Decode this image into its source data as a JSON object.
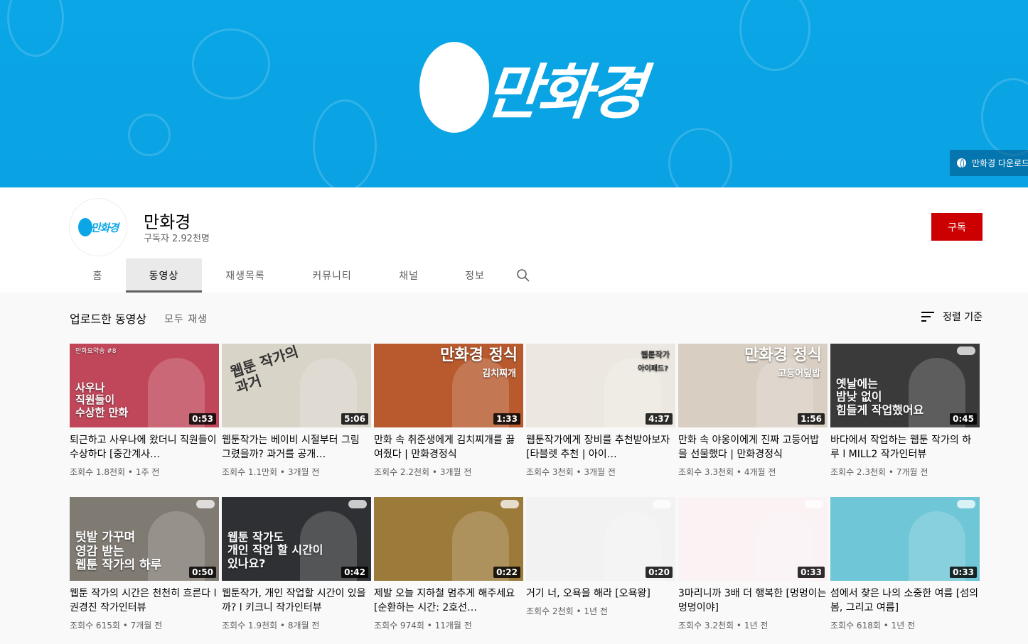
{
  "banner": {
    "logo_text": "만화경",
    "link_label": "만화경 다운로드"
  },
  "channel": {
    "avatar_text": "만화경",
    "name": "만화경",
    "subscribers": "구독자 2.92천명",
    "subscribe_label": "구독"
  },
  "tabs": [
    {
      "label": "홈"
    },
    {
      "label": "동영상",
      "active": true
    },
    {
      "label": "재생목록"
    },
    {
      "label": "커뮤니티"
    },
    {
      "label": "채널"
    },
    {
      "label": "정보"
    }
  ],
  "section": {
    "title": "업로드한 동영상",
    "play_all": "모두 재생",
    "sort_label": "정렬 기준"
  },
  "videos": [
    {
      "title": "퇴근하고 사우나에 왔더니 직원들이 수상하다 [중간계사…",
      "views": "조회수 1.8천회",
      "age": "1주 전",
      "duration": "0:53",
      "thumb_text": "사우나\n직원들이\n수상한 만화",
      "thumb_tag": "만화요약송 #8"
    },
    {
      "title": "웹툰작가는 베이비 시절부터 그림 그렸을까? 과거를 공개…",
      "views": "조회수 1.1만회",
      "age": "3개월 전",
      "duration": "5:06",
      "thumb_text": "웹툰 작가의\n과거"
    },
    {
      "title": "만화 속 취준생에게 김치찌개를 끓여줬다 | 만화경정식",
      "views": "조회수 2.2천회",
      "age": "3개월 전",
      "duration": "1:33",
      "thumb_text": "만화경 정식",
      "thumb_sub": "김치찌개"
    },
    {
      "title": "웹툰작가에게 장비를 추천받아보자 [타블렛 추천 | 아이…",
      "views": "조회수 3천회",
      "age": "3개월 전",
      "duration": "4:37",
      "thumb_text": "웹툰작가",
      "thumb_sub": "아이패드?"
    },
    {
      "title": "만화 속 야옹이에게 진짜 고등어밥을 선물했다 | 만화경정식",
      "views": "조회수 3.3천회",
      "age": "4개월 전",
      "duration": "1:56",
      "thumb_text": "만화경 정식",
      "thumb_sub": "고등어덮밥"
    },
    {
      "title": "바다에서 작업하는 웹툰 작가의 하루 l MILL2 작가인터뷰",
      "views": "조회수 2.3천회",
      "age": "7개월 전",
      "duration": "0:45",
      "thumb_text": "옛날에는\n밤낮 없이\n힘들게 작업했어요"
    },
    {
      "title": "웹툰 작가의 시간은 천천히 흐른다 l 권경진 작가인터뷰",
      "views": "조회수 615회",
      "age": "7개월 전",
      "duration": "0:50",
      "thumb_text": "텃밭 가꾸며\n영감 받는\n웹툰 작가의 하루"
    },
    {
      "title": "웹툰작가, 개인 작업할 시간이 있을까? l 키크니 작가인터뷰",
      "views": "조회수 1.9천회",
      "age": "8개월 전",
      "duration": "0:42",
      "thumb_text": "웹툰 작가도\n개인 작업 할 시간이\n있나요?"
    },
    {
      "title": "제발 오늘 지하철 멈추게 해주세요 [순환하는 시간: 2호선…",
      "views": "조회수 974회",
      "age": "11개월 전",
      "duration": "0:22",
      "thumb_text": ""
    },
    {
      "title": "거기 너, 오욕을 해라 [오욕왕]",
      "views": "조회수 2천회",
      "age": "1년 전",
      "duration": "0:20",
      "thumb_text": ""
    },
    {
      "title": "3마리니까 3배 더 행복한 [멍멍이는 멍멍이야]",
      "views": "조회수 3.2천회",
      "age": "1년 전",
      "duration": "0:33",
      "thumb_text": ""
    },
    {
      "title": "섬에서 찾은 나의 소중한 여름 [섬의 봄, 그리고 여름]",
      "views": "조회수 618회",
      "age": "1년 전",
      "duration": "0:33",
      "thumb_text": ""
    }
  ],
  "colors": {
    "banner": "#0aa6e6",
    "subscribe": "#cc0000",
    "thumb_bgs": [
      "#c0475a",
      "#d9d4c8",
      "#b85a2e",
      "#ece8e1",
      "#d8cfc2",
      "#3a3a3a",
      "#7f7a72",
      "#2e3033",
      "#9c7a3a",
      "#f2f2f2",
      "#fbf2f4",
      "#6ec6d6"
    ]
  }
}
